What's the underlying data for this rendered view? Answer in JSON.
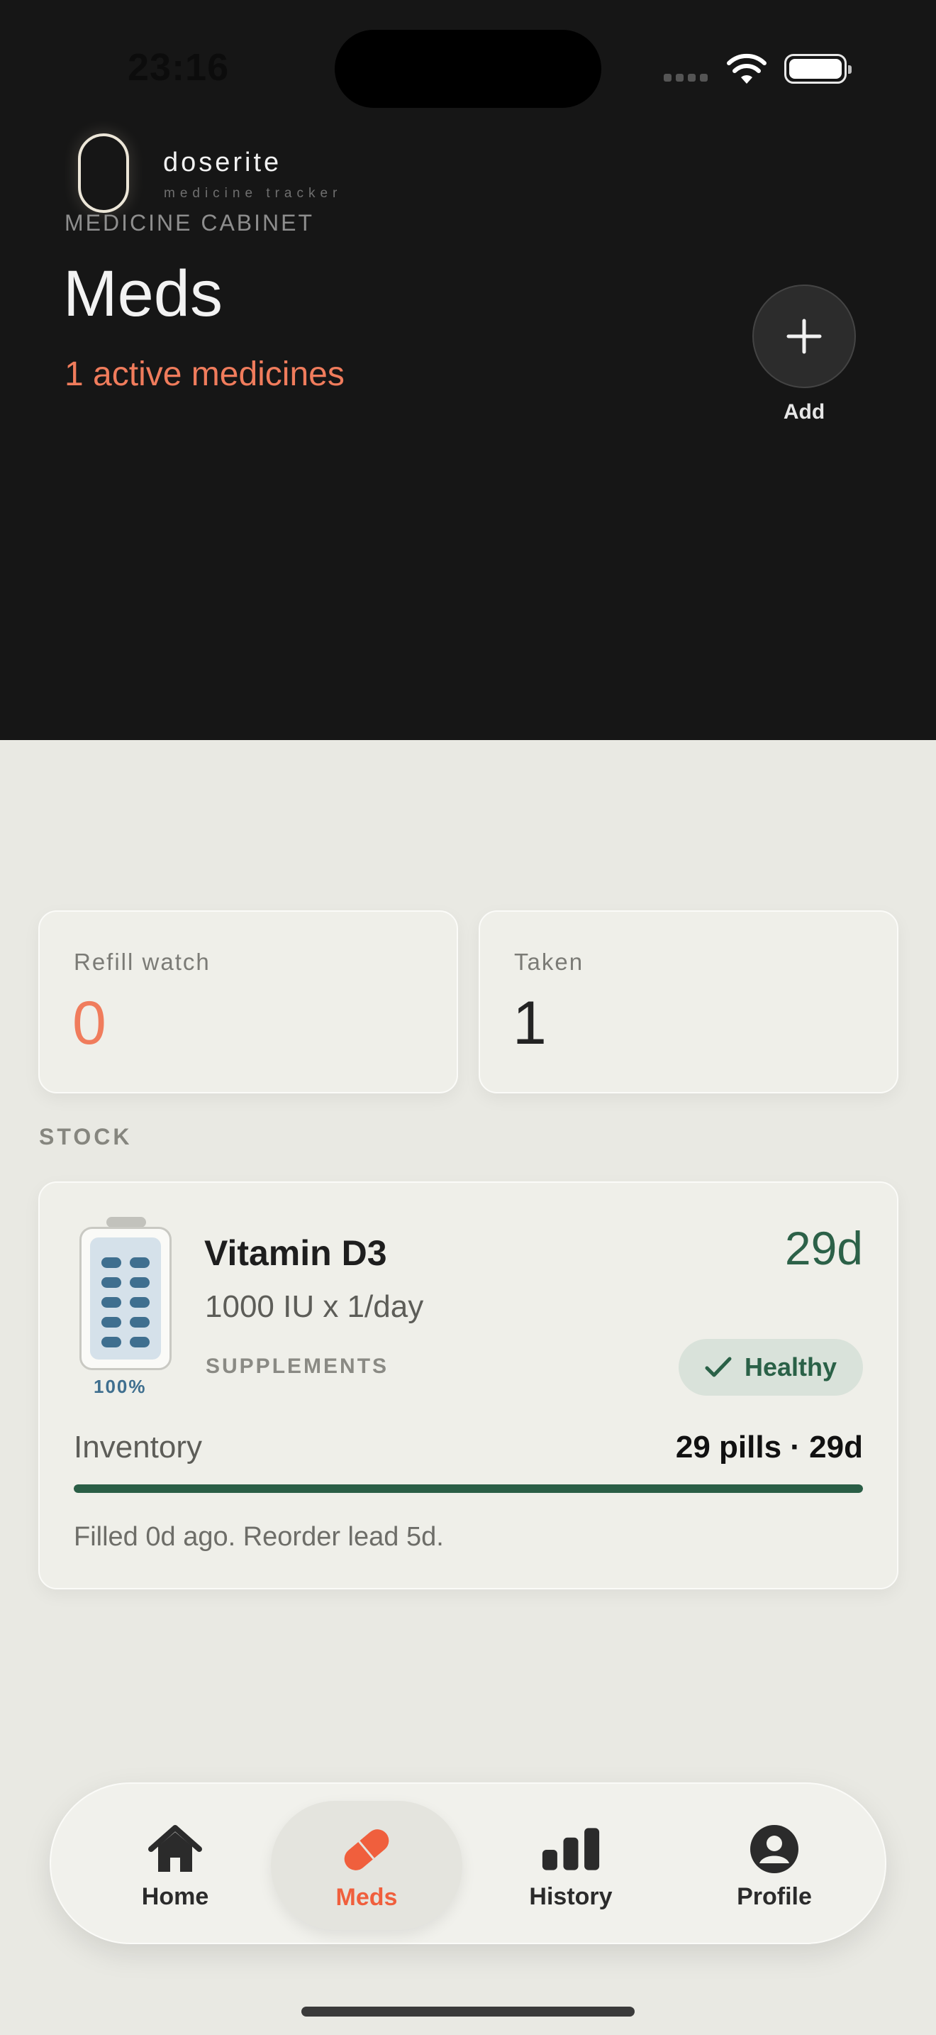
{
  "status_bar": {
    "time": "23:16"
  },
  "brand": {
    "name": "doserite",
    "tagline": "medicine tracker"
  },
  "header": {
    "eyebrow": "MEDICINE CABINET",
    "title": "Meds",
    "subtitle": "1 active medicines",
    "add_label": "Add"
  },
  "stats": [
    {
      "label": "Refill watch",
      "value": "0",
      "color": "#f07c5c"
    },
    {
      "label": "Taken",
      "value": "1",
      "color": "#232323"
    }
  ],
  "section": {
    "stock_label": "STOCK"
  },
  "medicine": {
    "name": "Vitamin D3",
    "dose": "1000 IU x 1/day",
    "category": "SUPPLEMENTS",
    "days_left": "29d",
    "bottle_percent": "100%",
    "bottle_level": 1.0,
    "status": "Healthy",
    "inventory_label": "Inventory",
    "inventory_value": "29 pills · 29d",
    "inventory_fraction": 1.0,
    "footnote": "Filled 0d ago. Reorder lead 5d."
  },
  "tabs": [
    {
      "label": "Home",
      "icon": "house-icon",
      "active": false
    },
    {
      "label": "Meds",
      "icon": "pill-icon",
      "active": true
    },
    {
      "label": "History",
      "icon": "bar-chart-icon",
      "active": false
    },
    {
      "label": "Profile",
      "icon": "person-icon",
      "active": false
    }
  ],
  "colors": {
    "accent": "#f05f3d",
    "healthy": "#2a6147",
    "header_bg": "#161616",
    "page_bg": "#e9e9e3"
  }
}
